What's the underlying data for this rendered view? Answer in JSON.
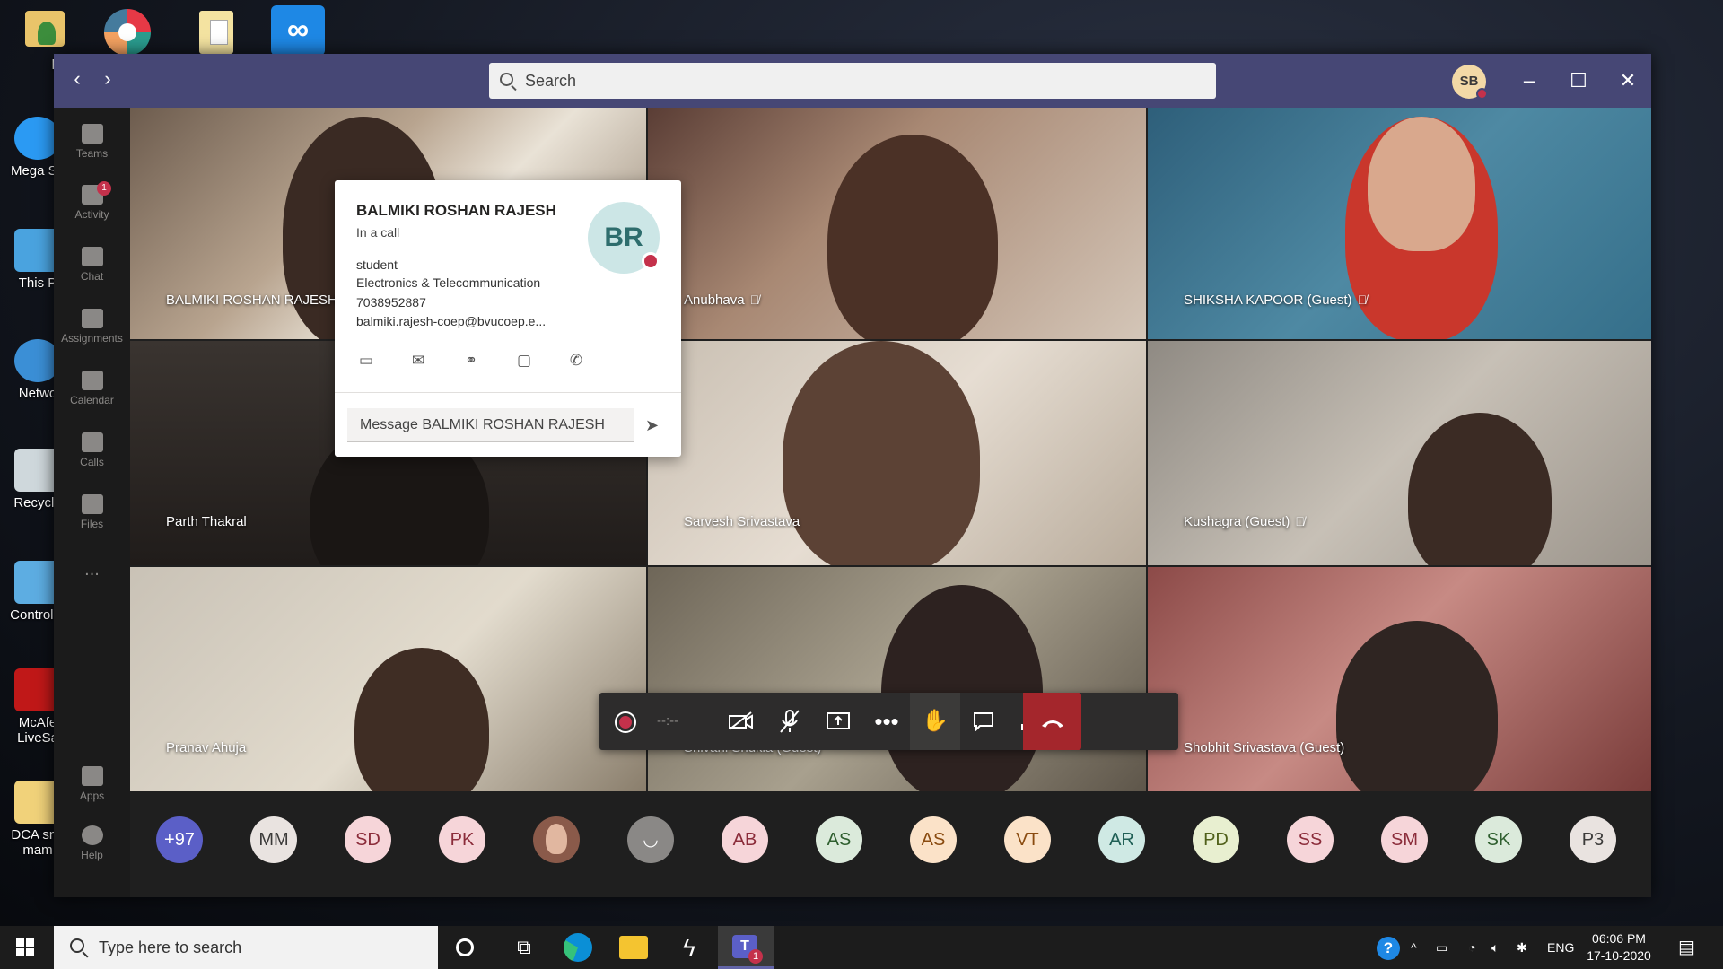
{
  "desktop": {
    "top_icons": [
      {
        "label": "hp",
        "icon": "folder-user-icon"
      },
      {
        "label": "",
        "icon": "picasa-icon"
      },
      {
        "label": "",
        "icon": "document-folder-icon"
      },
      {
        "label": "",
        "icon": "infinity-app-icon"
      }
    ],
    "left_icons": [
      {
        "label": "Mega Sh",
        "icon": "media-player-icon"
      },
      {
        "label": "This P",
        "icon": "computer-icon"
      },
      {
        "label": "Netwo",
        "icon": "network-icon"
      },
      {
        "label": "Recycle",
        "icon": "recycle-bin-icon"
      },
      {
        "label": "Control F",
        "icon": "control-panel-icon"
      },
      {
        "label": "McAfe LiveSa",
        "icon": "mcafee-icon"
      },
      {
        "label": "DCA sne mam",
        "icon": "document-icon"
      }
    ]
  },
  "titlebar": {
    "search_placeholder": "Search",
    "me_initials": "SB",
    "me_status_color": "#c4314b"
  },
  "rail": {
    "items": [
      {
        "label": "Teams",
        "icon": "teams-icon"
      },
      {
        "label": "Activity",
        "icon": "bell-icon",
        "badge": "1"
      },
      {
        "label": "Chat",
        "icon": "chat-icon"
      },
      {
        "label": "Assignments",
        "icon": "assignments-icon"
      },
      {
        "label": "Calendar",
        "icon": "calendar-icon"
      },
      {
        "label": "Calls",
        "icon": "phone-icon"
      },
      {
        "label": "Files",
        "icon": "file-icon"
      },
      {
        "label": "...",
        "icon": "more-icon"
      },
      {
        "label": "Apps",
        "icon": "apps-icon"
      },
      {
        "label": "Help",
        "icon": "help-icon"
      }
    ]
  },
  "video_tiles": [
    {
      "name": "BALMIKI ROSHAN RAJESH",
      "muted": false
    },
    {
      "name": "Anubhava",
      "muted": true
    },
    {
      "name": "SHIKSHA KAPOOR (Guest)",
      "muted": true
    },
    {
      "name": "Parth Thakral",
      "muted": false
    },
    {
      "name": "Sarvesh Srivastava",
      "muted": false
    },
    {
      "name": "Kushagra (Guest)",
      "muted": true
    },
    {
      "name": "Pranav Ahuja",
      "muted": false
    },
    {
      "name": "Shivani Shukla (Guest)",
      "muted": true
    },
    {
      "name": "Shobhit Srivastava (Guest)",
      "muted": false
    }
  ],
  "profile_card": {
    "name": "BALMIKI ROSHAN RAJESH",
    "status": "In a call",
    "role": "student",
    "department": "Electronics & Telecommunication",
    "phone": "7038952887",
    "email": "balmiki.rajesh-coep@bvucoep.e...",
    "initials": "BR",
    "presence_color": "#c4314b",
    "message_placeholder": "Message BALMIKI ROSHAN RAJESH"
  },
  "call_controls": {
    "timer": "--:--"
  },
  "participants": [
    {
      "label": "+97",
      "bg": "#5b5fc7",
      "fg": "#ffffff"
    },
    {
      "label": "MM",
      "bg": "#e9e3e0",
      "fg": "#3b3a39"
    },
    {
      "label": "SD",
      "bg": "#f6d5d9",
      "fg": "#8b2c3a"
    },
    {
      "label": "PK",
      "bg": "#f6d5d9",
      "fg": "#8b2c3a"
    },
    {
      "label": "",
      "bg": "#8a5a4a",
      "fg": "#ffffff",
      "photo": true
    },
    {
      "label": "",
      "bg": "#8a8886",
      "fg": "#ffffff",
      "icon": "person-icon"
    },
    {
      "label": "AB",
      "bg": "#f6d5d9",
      "fg": "#8b2c3a"
    },
    {
      "label": "AS",
      "bg": "#dbeadb",
      "fg": "#2f5f2f"
    },
    {
      "label": "AS",
      "bg": "#fbe2c8",
      "fg": "#8a4b10"
    },
    {
      "label": "VT",
      "bg": "#fbe2c8",
      "fg": "#8a4b10"
    },
    {
      "label": "AR",
      "bg": "#cfe9e4",
      "fg": "#1f5f55"
    },
    {
      "label": "PD",
      "bg": "#e8efd0",
      "fg": "#50601a"
    },
    {
      "label": "SS",
      "bg": "#f6d5d9",
      "fg": "#8b2c3a"
    },
    {
      "label": "SM",
      "bg": "#f6d5d9",
      "fg": "#8b2c3a"
    },
    {
      "label": "SK",
      "bg": "#dbeadb",
      "fg": "#2f5f2f"
    },
    {
      "label": "P3",
      "bg": "#e9e3e0",
      "fg": "#3b3a39"
    }
  ],
  "taskbar": {
    "search_placeholder": "Type here to search",
    "language": "ENG",
    "time": "06:06 PM",
    "date": "17-10-2020",
    "teams_badge": "1"
  }
}
